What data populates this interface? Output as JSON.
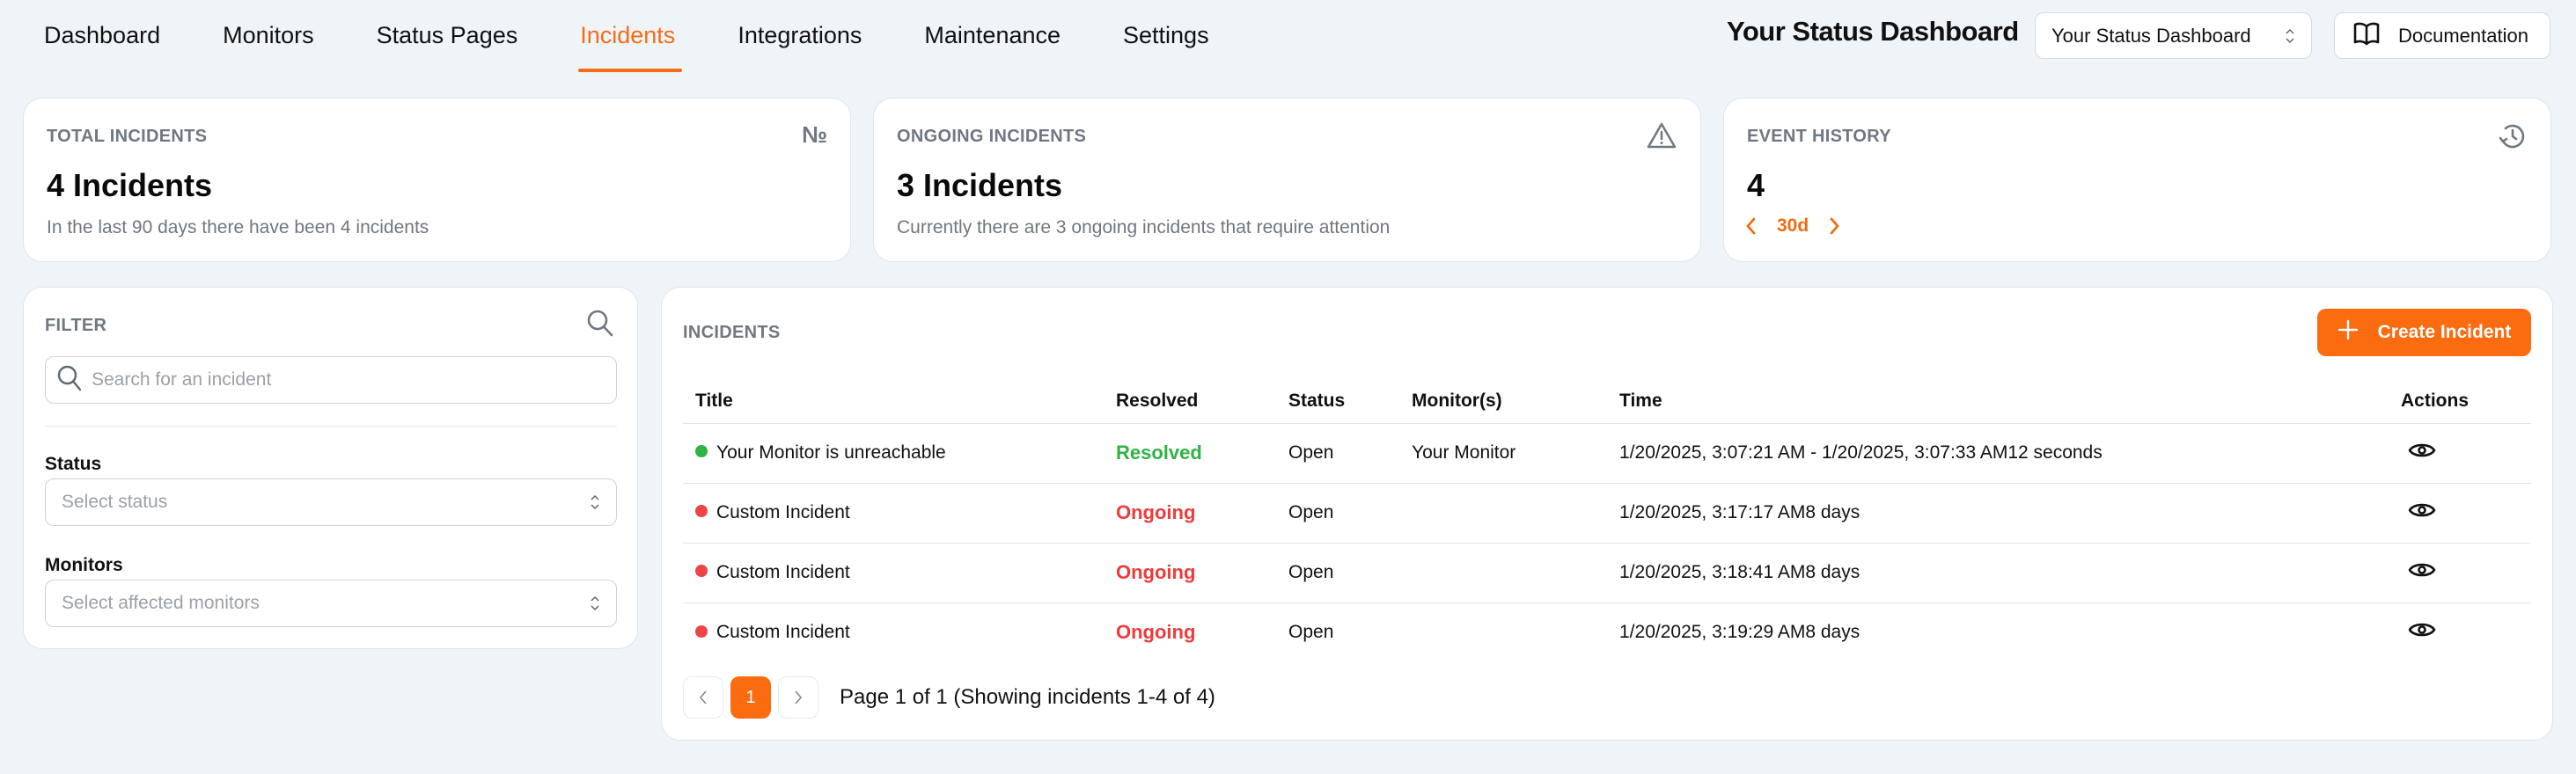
{
  "nav": {
    "items": [
      {
        "label": "Dashboard",
        "active": false
      },
      {
        "label": "Monitors",
        "active": false
      },
      {
        "label": "Status Pages",
        "active": false
      },
      {
        "label": "Incidents",
        "active": true
      },
      {
        "label": "Integrations",
        "active": false
      },
      {
        "label": "Maintenance",
        "active": false
      },
      {
        "label": "Settings",
        "active": false
      }
    ],
    "brand_title": "Your Status Dashboard",
    "dashboard_select_value": "Your Status Dashboard",
    "documentation_label": "Documentation"
  },
  "stats": {
    "total": {
      "label": "TOTAL INCIDENTS",
      "icon": "numero-icon",
      "icon_glyph": "№",
      "value": "4 Incidents",
      "sub": "In the last 90 days there have been 4 incidents"
    },
    "ongoing": {
      "label": "ONGOING INCIDENTS",
      "icon": "warning-triangle-icon",
      "value": "3 Incidents",
      "sub": "Currently there are 3 ongoing incidents that require attention"
    },
    "history": {
      "label": "EVENT HISTORY",
      "icon": "history-icon",
      "value": "4",
      "range": "30d"
    }
  },
  "filter": {
    "label": "FILTER",
    "search_placeholder": "Search for an incident",
    "status_label": "Status",
    "status_placeholder": "Select status",
    "monitors_label": "Monitors",
    "monitors_placeholder": "Select affected monitors"
  },
  "incidents": {
    "label": "INCIDENTS",
    "create_label": "Create Incident",
    "columns": [
      "Title",
      "Resolved",
      "Status",
      "Monitor(s)",
      "Time",
      "Actions"
    ],
    "rows": [
      {
        "title": "Your Monitor is unreachable",
        "dot_color": "#2fb344",
        "resolved": "Resolved",
        "resolved_state": "yes",
        "status": "Open",
        "monitors": "Your Monitor",
        "time": "1/20/2025, 3:07:21 AM - 1/20/2025, 3:07:33 AM12 seconds"
      },
      {
        "title": "Custom Incident",
        "dot_color": "#ef4444",
        "resolved": "Ongoing",
        "resolved_state": "no",
        "status": "Open",
        "monitors": "",
        "time": "1/20/2025, 3:17:17 AM8 days"
      },
      {
        "title": "Custom Incident",
        "dot_color": "#ef4444",
        "resolved": "Ongoing",
        "resolved_state": "no",
        "status": "Open",
        "monitors": "",
        "time": "1/20/2025, 3:18:41 AM8 days"
      },
      {
        "title": "Custom Incident",
        "dot_color": "#ef4444",
        "resolved": "Ongoing",
        "resolved_state": "no",
        "status": "Open",
        "monitors": "",
        "time": "1/20/2025, 3:19:29 AM8 days"
      }
    ],
    "pagination": {
      "current_page": "1",
      "summary": "Page 1 of 1 (Showing incidents 1-4 of 4)"
    }
  },
  "colors": {
    "accent": "#f26d13",
    "button": "#fb6b10",
    "resolved": "#2fb344",
    "ongoing": "#ef3b3b",
    "muted": "#6f7781"
  }
}
